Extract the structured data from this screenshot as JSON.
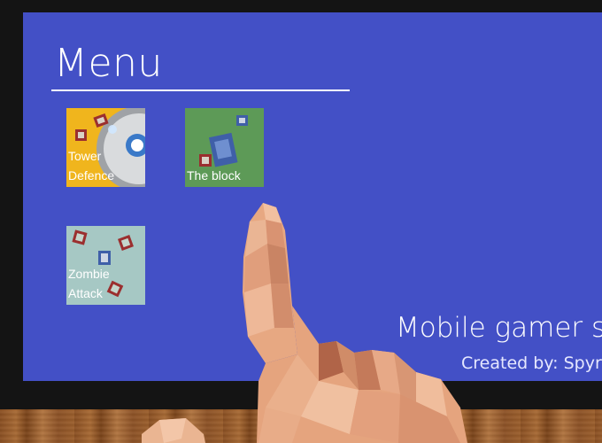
{
  "menu": {
    "title": "Menu",
    "tiles": [
      {
        "label_line1": "Tower",
        "label_line2": "Defence",
        "color": "#f0b51d"
      },
      {
        "label_line1": "The block",
        "label_line2": "",
        "color": "#5d9a57"
      },
      {
        "label_line1": "Zombie",
        "label_line2": "Attack",
        "color": "#a6c8c4"
      }
    ]
  },
  "footer": {
    "tagline": "Mobile gamer sir",
    "credit": "Created by: Spyr"
  },
  "colors": {
    "screen_background": "#4350c6",
    "bezel": "#141414",
    "floor_wood": "#9c5f2c"
  },
  "icons": {
    "pointing_hand": "pointing-hand-icon",
    "tank": "tank-icon",
    "turret": "turret-icon"
  }
}
